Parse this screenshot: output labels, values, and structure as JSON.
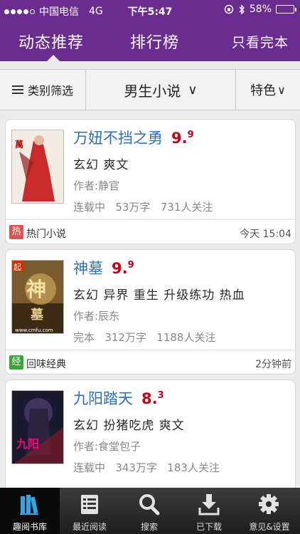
{
  "status_bar": {
    "carrier": "中国电信",
    "network": "4G",
    "time": "下午5:47",
    "battery": "58%",
    "battery_level": 0.58
  },
  "top_tabs": [
    "动态推荐",
    "排行榜",
    "只看完本"
  ],
  "filters": {
    "category": "类别筛选",
    "selected": "男生小说",
    "selected_arrow": "∨",
    "feature": "特色",
    "feature_arrow": "∨"
  },
  "books": [
    {
      "title": "万妞不挡之勇",
      "score_main": "9.",
      "score_decimal": "9",
      "tags": "玄幻 爽文",
      "author": "作者:静官",
      "status": "连载中",
      "words": "53万字",
      "followers": "731人关注",
      "footer_badge": "热",
      "footer_label": "热门小说",
      "footer_time": "今天 15:04",
      "badge_color": "#d9534f"
    },
    {
      "title": "神墓",
      "score_main": "9.",
      "score_decimal": "9",
      "tags": "玄幻 异界 重生 升级练功 热血",
      "author": "作者:辰东",
      "status": "完本",
      "words": "312万字",
      "followers": "1188人关注",
      "footer_badge": "经",
      "footer_label": "回味经典",
      "footer_time": "2分钟前",
      "badge_color": "#3aa63a"
    },
    {
      "title": "九阳踏天",
      "score_main": "8.",
      "score_decimal": "3",
      "tags": "玄幻 扮猪吃虎 爽文",
      "author": "作者:食堂包子",
      "status": "连载中",
      "words": "343万字",
      "followers": "183人关注"
    }
  ],
  "tab_bar": [
    {
      "label": "趣阅书库",
      "icon": "books-icon"
    },
    {
      "label": "最近阅读",
      "icon": "recent-list-icon"
    },
    {
      "label": "搜索",
      "icon": "search-icon"
    },
    {
      "label": "已下载",
      "icon": "download-icon"
    },
    {
      "label": "意见&设置",
      "icon": "gear-icon"
    }
  ],
  "colors": {
    "brand_purple": "#6a2c8e",
    "title_blue": "#2a6fb8",
    "score_red": "#c2001a"
  }
}
